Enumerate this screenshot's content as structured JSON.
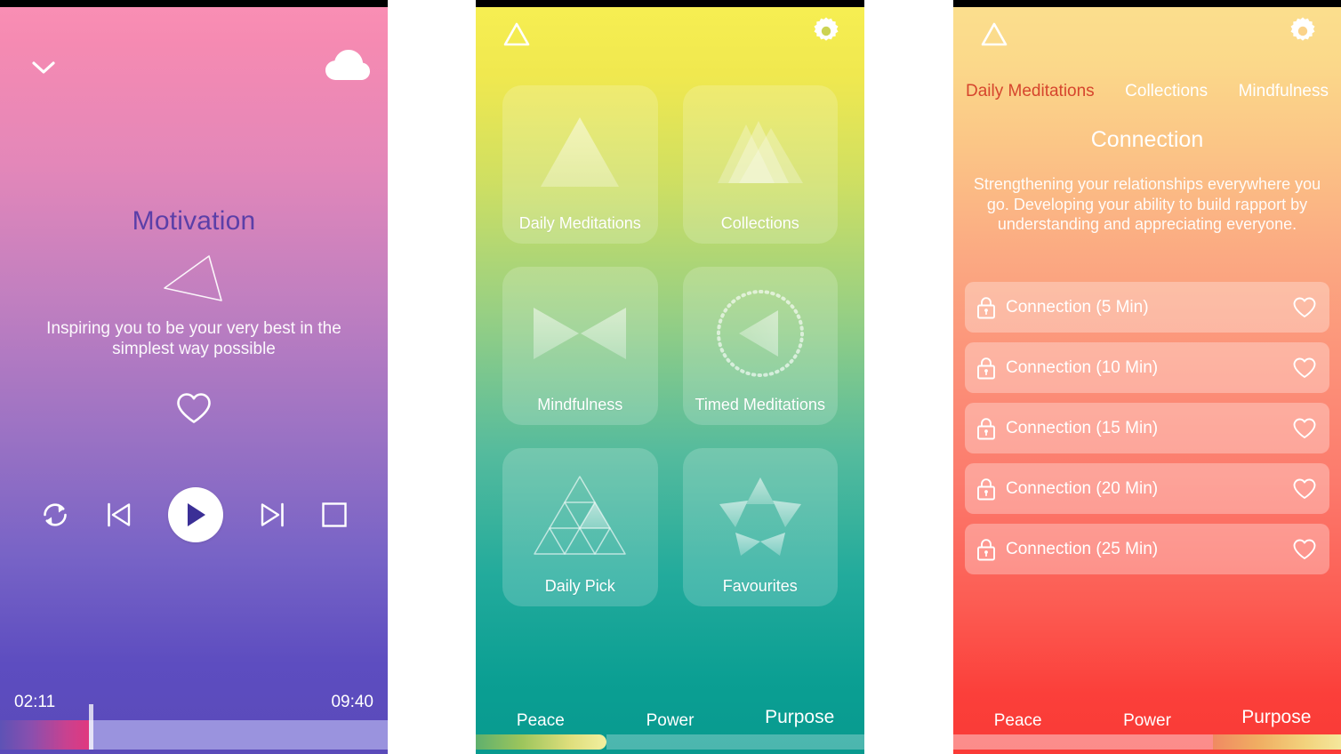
{
  "player": {
    "collapse_icon": "chevron-down-icon",
    "download_icon": "cloud-download-icon",
    "title": "Motivation",
    "art_icon": "triangle-outline-icon",
    "description": "Inspiring you to be your very best in the simplest way possible",
    "favorite_icon": "heart-outline-icon",
    "controls": {
      "repeat_label": "repeat-icon",
      "previous_label": "previous-track-icon",
      "play_label": "play-icon",
      "next_label": "next-track-icon",
      "stop_label": "stop-icon"
    },
    "elapsed_time": "02:11",
    "total_time": "09:40",
    "progress_percent": 22.9,
    "colors": {
      "top": "#fa8fb4",
      "bottom": "#5a4ab9",
      "title": "#5b3fa8",
      "progress_track": "#9a93de"
    }
  },
  "home": {
    "logo_icon": "triangle-outline-icon",
    "settings_icon": "gear-icon",
    "tiles": [
      {
        "label": "Daily Meditations",
        "icon": "single-triangle-icon"
      },
      {
        "label": "Collections",
        "icon": "stacked-triangles-icon"
      },
      {
        "label": "Mindfulness",
        "icon": "bowtie-triangles-icon"
      },
      {
        "label": "Timed Meditations",
        "icon": "dotted-circle-play-icon"
      },
      {
        "label": "Daily Pick",
        "icon": "triangle-grid-icon"
      },
      {
        "label": "Favourites",
        "icon": "star-triangles-icon"
      }
    ],
    "bottom_nav": [
      {
        "label": "Peace",
        "active": true
      },
      {
        "label": "Power",
        "active": false
      },
      {
        "label": "Purpose",
        "active": false
      }
    ],
    "colors": {
      "top": "#f7ef52",
      "bottom": "#089a8f"
    }
  },
  "category": {
    "logo_icon": "triangle-outline-icon",
    "settings_icon": "gear-icon",
    "tabs": [
      {
        "label": "Daily Meditations",
        "active": true
      },
      {
        "label": "Collections",
        "active": false
      },
      {
        "label": "Mindfulness",
        "active": false
      }
    ],
    "title": "Connection",
    "description": "Strengthening your relationships everywhere you go. Developing your ability to build rapport by understanding and appreciating everyone.",
    "rows": [
      {
        "label": "Connection (5 Min)",
        "lock_icon": "lock-icon",
        "favorite_icon": "heart-outline-icon"
      },
      {
        "label": "Connection (10 Min)",
        "lock_icon": "lock-icon",
        "favorite_icon": "heart-outline-icon"
      },
      {
        "label": "Connection (15 Min)",
        "lock_icon": "lock-icon",
        "favorite_icon": "heart-outline-icon"
      },
      {
        "label": "Connection (20 Min)",
        "lock_icon": "lock-icon",
        "favorite_icon": "heart-outline-icon"
      },
      {
        "label": "Connection (25 Min)",
        "lock_icon": "lock-icon",
        "favorite_icon": "heart-outline-icon"
      }
    ],
    "bottom_nav": [
      {
        "label": "Peace",
        "active": false
      },
      {
        "label": "Power",
        "active": false
      },
      {
        "label": "Purpose",
        "active": true
      }
    ],
    "colors": {
      "top": "#fbdf8e",
      "bottom": "#fa3a36",
      "active_tab": "#d6452d"
    }
  }
}
